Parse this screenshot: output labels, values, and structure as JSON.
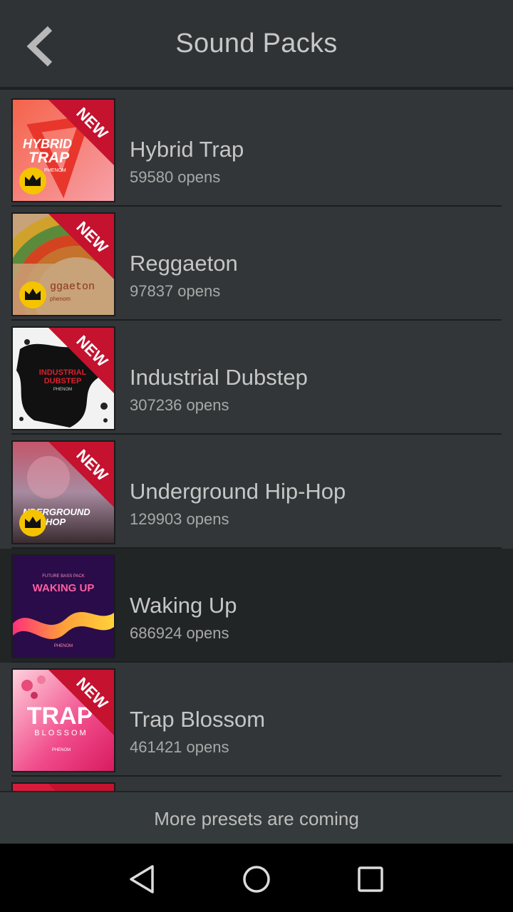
{
  "header": {
    "title": "Sound Packs",
    "back_icon": "chevron-left-icon"
  },
  "packs": [
    {
      "title": "Hybrid Trap",
      "opens": "59580 opens",
      "is_new": true,
      "premium": true,
      "cover_text": [
        "HYBRID",
        "TRAP",
        "PHENOM"
      ],
      "badge": "NEW"
    },
    {
      "title": "Reggaeton",
      "opens": "97837 opens",
      "is_new": true,
      "premium": true,
      "cover_text": [
        "ggaeton",
        "phenom"
      ],
      "badge": "NEW"
    },
    {
      "title": "Industrial Dubstep",
      "opens": "307236 opens",
      "is_new": true,
      "premium": false,
      "cover_text": [
        "INDUSTRIAL",
        "DUBSTEP",
        "PHENOM"
      ],
      "badge": "NEW"
    },
    {
      "title": "Underground Hip-Hop",
      "opens": "129903 opens",
      "is_new": true,
      "premium": true,
      "cover_text": [
        "NDERGROUND",
        "HOP"
      ],
      "badge": "NEW"
    },
    {
      "title": "Waking Up",
      "opens": "686924 opens",
      "is_new": false,
      "premium": false,
      "cover_text": [
        "FUTURE BASS PACK",
        "WAKING UP",
        "PHENOM"
      ],
      "badge": ""
    },
    {
      "title": "Trap Blossom",
      "opens": "461421 opens",
      "is_new": true,
      "premium": false,
      "cover_text": [
        "TRAP",
        "BLOSSOM",
        "PHENOM"
      ],
      "badge": "NEW"
    }
  ],
  "footer": {
    "text": "More presets are coming"
  },
  "navbar": {
    "back_icon": "triangle-back-icon",
    "home_icon": "circle-home-icon",
    "recents_icon": "square-recents-icon"
  },
  "colors": {
    "new_ribbon": "#c4122f",
    "premium_badge": "#f5c400",
    "active_row": "#222526",
    "background": "#323638"
  }
}
